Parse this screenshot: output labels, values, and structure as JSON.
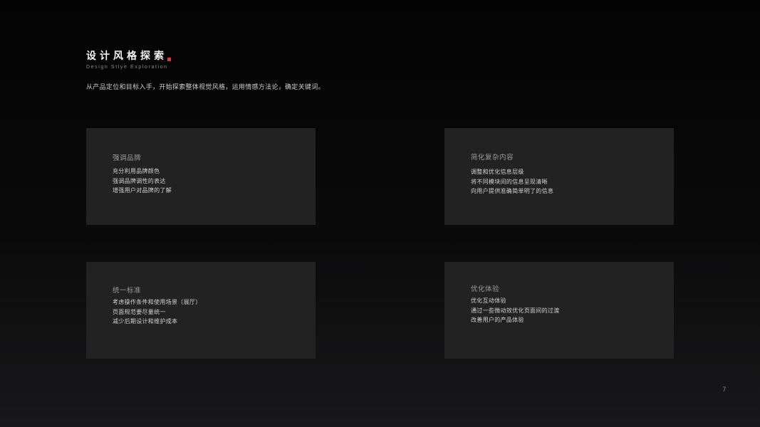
{
  "header": {
    "title": "设计风格探索",
    "subtitle": "Design Stlye Exploration"
  },
  "intro": "从产品定位和目标入手，开始探索整体视觉风格，运用情感方法论，确定关键词。",
  "cards": [
    {
      "title": "强调品牌",
      "items": [
        "充分利用品牌颜色",
        "强调品牌调性的表达",
        "增强用户对品牌的了解"
      ]
    },
    {
      "title": "简化复杂内容",
      "items": [
        "调整和优化信息层级",
        "将不同模块间的信息呈现清晰",
        "向用户提供准确简单明了的信息"
      ]
    },
    {
      "title": "统一标准",
      "items": [
        "考虑操作条件和使用场景（展厅）",
        "页面规范要尽量统一",
        "减少后期设计和维护成本"
      ]
    },
    {
      "title": "优化体验",
      "items": [
        "优化互动体验",
        "通过一些微动效优化页面间的过渡",
        "改善用户的产品体验"
      ]
    }
  ],
  "page_number": "7",
  "colors": {
    "accent": "#e5322d",
    "card_background": "#222223"
  }
}
